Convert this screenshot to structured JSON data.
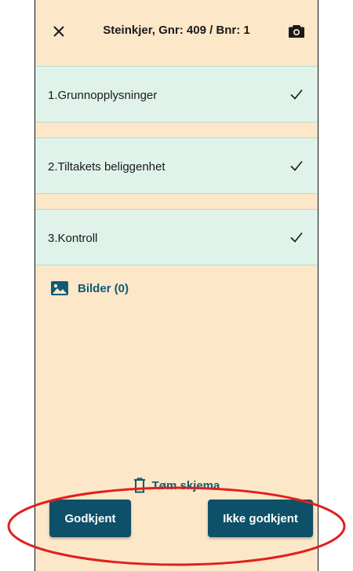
{
  "header": {
    "title": "Steinkjer, Gnr: 409 / Bnr: 1",
    "close_icon": "close-icon",
    "camera_icon": "camera-icon"
  },
  "sections": [
    {
      "label": "1.Grunnopplysninger",
      "completed": true
    },
    {
      "label": "2.Tiltakets beliggenhet",
      "completed": true
    },
    {
      "label": "3.Kontroll",
      "completed": true
    }
  ],
  "images": {
    "label": "Bilder (0)",
    "icon": "image-icon"
  },
  "clear_form": {
    "label": "Tøm skjema",
    "icon": "trash-icon"
  },
  "actions": {
    "approve_label": "Godkjent",
    "reject_label": "Ikke godkjent"
  },
  "colors": {
    "background": "#fde7c9",
    "section_bg": "#dff3ea",
    "primary": "#0d5068",
    "link": "#0e5b73",
    "annotation": "#e0201b"
  }
}
